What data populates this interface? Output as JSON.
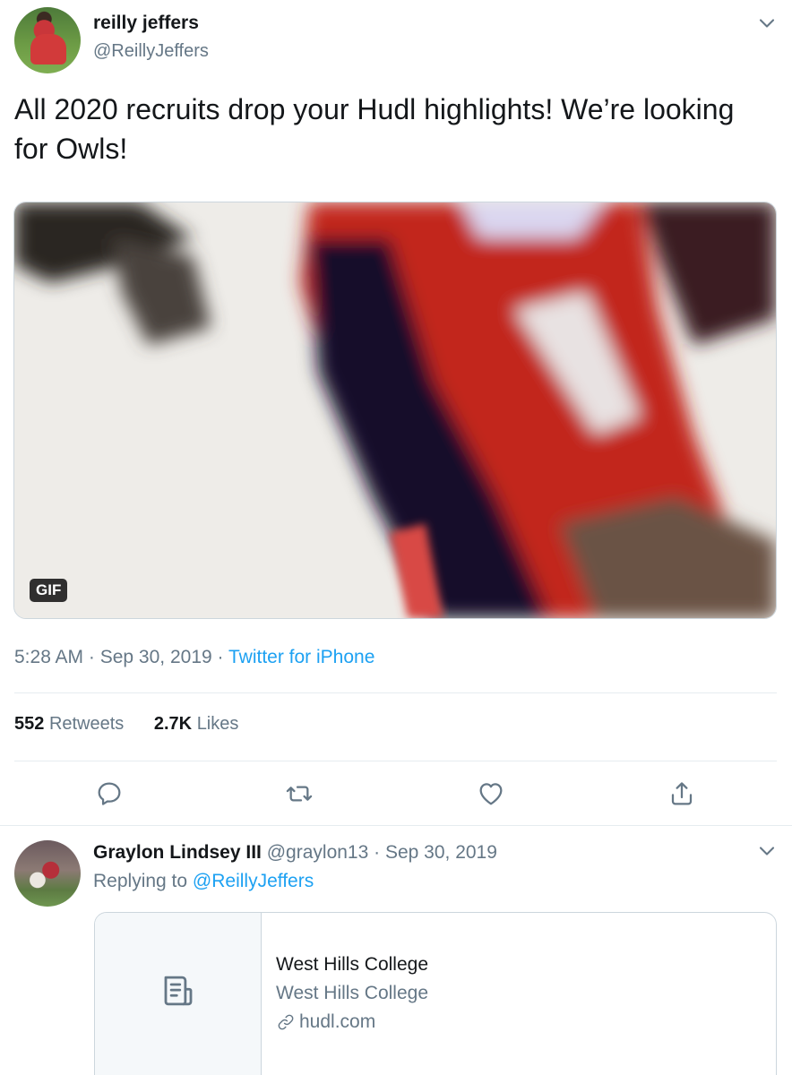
{
  "tweet": {
    "display_name": "reilly jeffers",
    "handle": "@ReillyJeffers",
    "text": "All 2020 recruits drop your Hudl highlights! We’re looking for Owls!",
    "media_badge": "GIF",
    "time": "5:28 AM",
    "date": "Sep 30, 2019",
    "source": "Twitter for iPhone",
    "retweets_count": "552",
    "retweets_label": "Retweets",
    "likes_count": "2.7K",
    "likes_label": "Likes",
    "actions": [
      "reply-icon",
      "retweet-icon",
      "like-icon",
      "share-icon"
    ]
  },
  "reply": {
    "display_name": "Graylon Lindsey III",
    "handle": "@graylon13",
    "date": "Sep 30, 2019",
    "replying_prefix": "Replying to",
    "replying_to": "@ReillyJeffers",
    "card": {
      "title": "West Hills College",
      "description": "West Hills College",
      "domain": "hudl.com",
      "thumb_icon": "document-icon",
      "domain_icon": "link-icon"
    }
  },
  "colors": {
    "accent": "#1da1f2",
    "text": "#14171a",
    "secondary": "#657786",
    "border": "#e6ecf0"
  }
}
